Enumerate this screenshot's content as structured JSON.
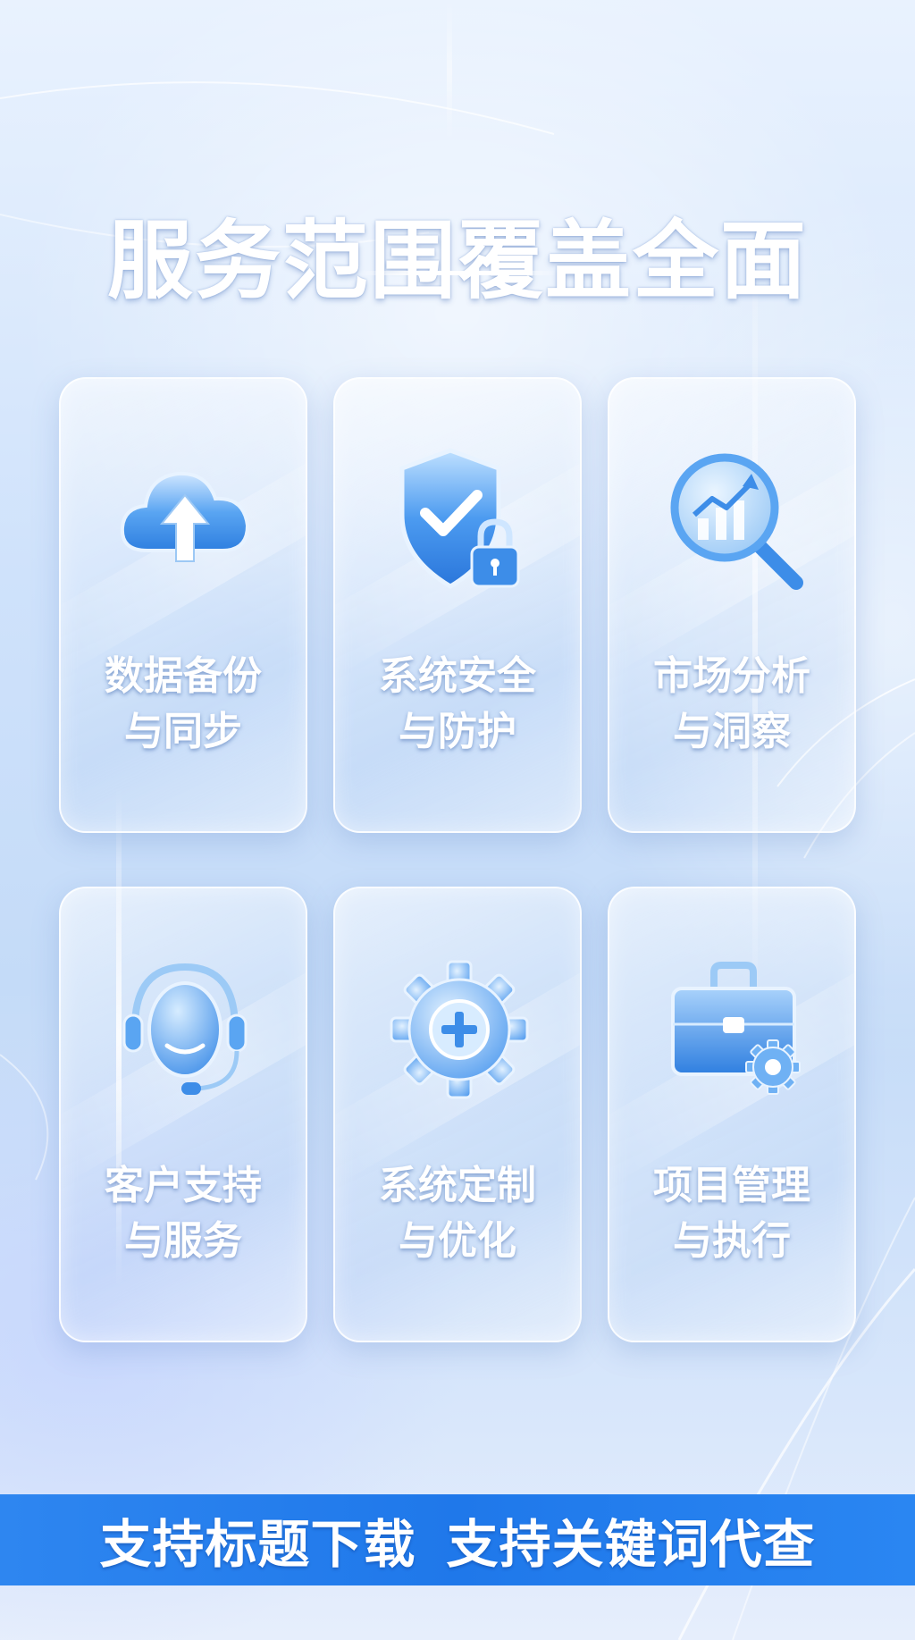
{
  "header": {
    "title": "服务范围覆盖全面"
  },
  "cards": [
    {
      "icon": "cloud-upload-icon",
      "line1": "数据备份",
      "line2": "与同步"
    },
    {
      "icon": "shield-lock-icon",
      "line1": "系统安全",
      "line2": "与防护"
    },
    {
      "icon": "magnifier-chart-icon",
      "line1": "市场分析",
      "line2": "与洞察"
    },
    {
      "icon": "headset-support-icon",
      "line1": "客户支持",
      "line2": "与服务"
    },
    {
      "icon": "gear-plus-icon",
      "line1": "系统定制",
      "line2": "与优化"
    },
    {
      "icon": "briefcase-gear-icon",
      "line1": "项目管理",
      "line2": "与执行"
    }
  ],
  "banner": {
    "left_text": "支持标题下载",
    "right_text": "支持关键词代查"
  },
  "colors": {
    "banner_blue": "#1f78ea",
    "icon_blue": "#3d8de8",
    "text_white": "#ffffff"
  }
}
